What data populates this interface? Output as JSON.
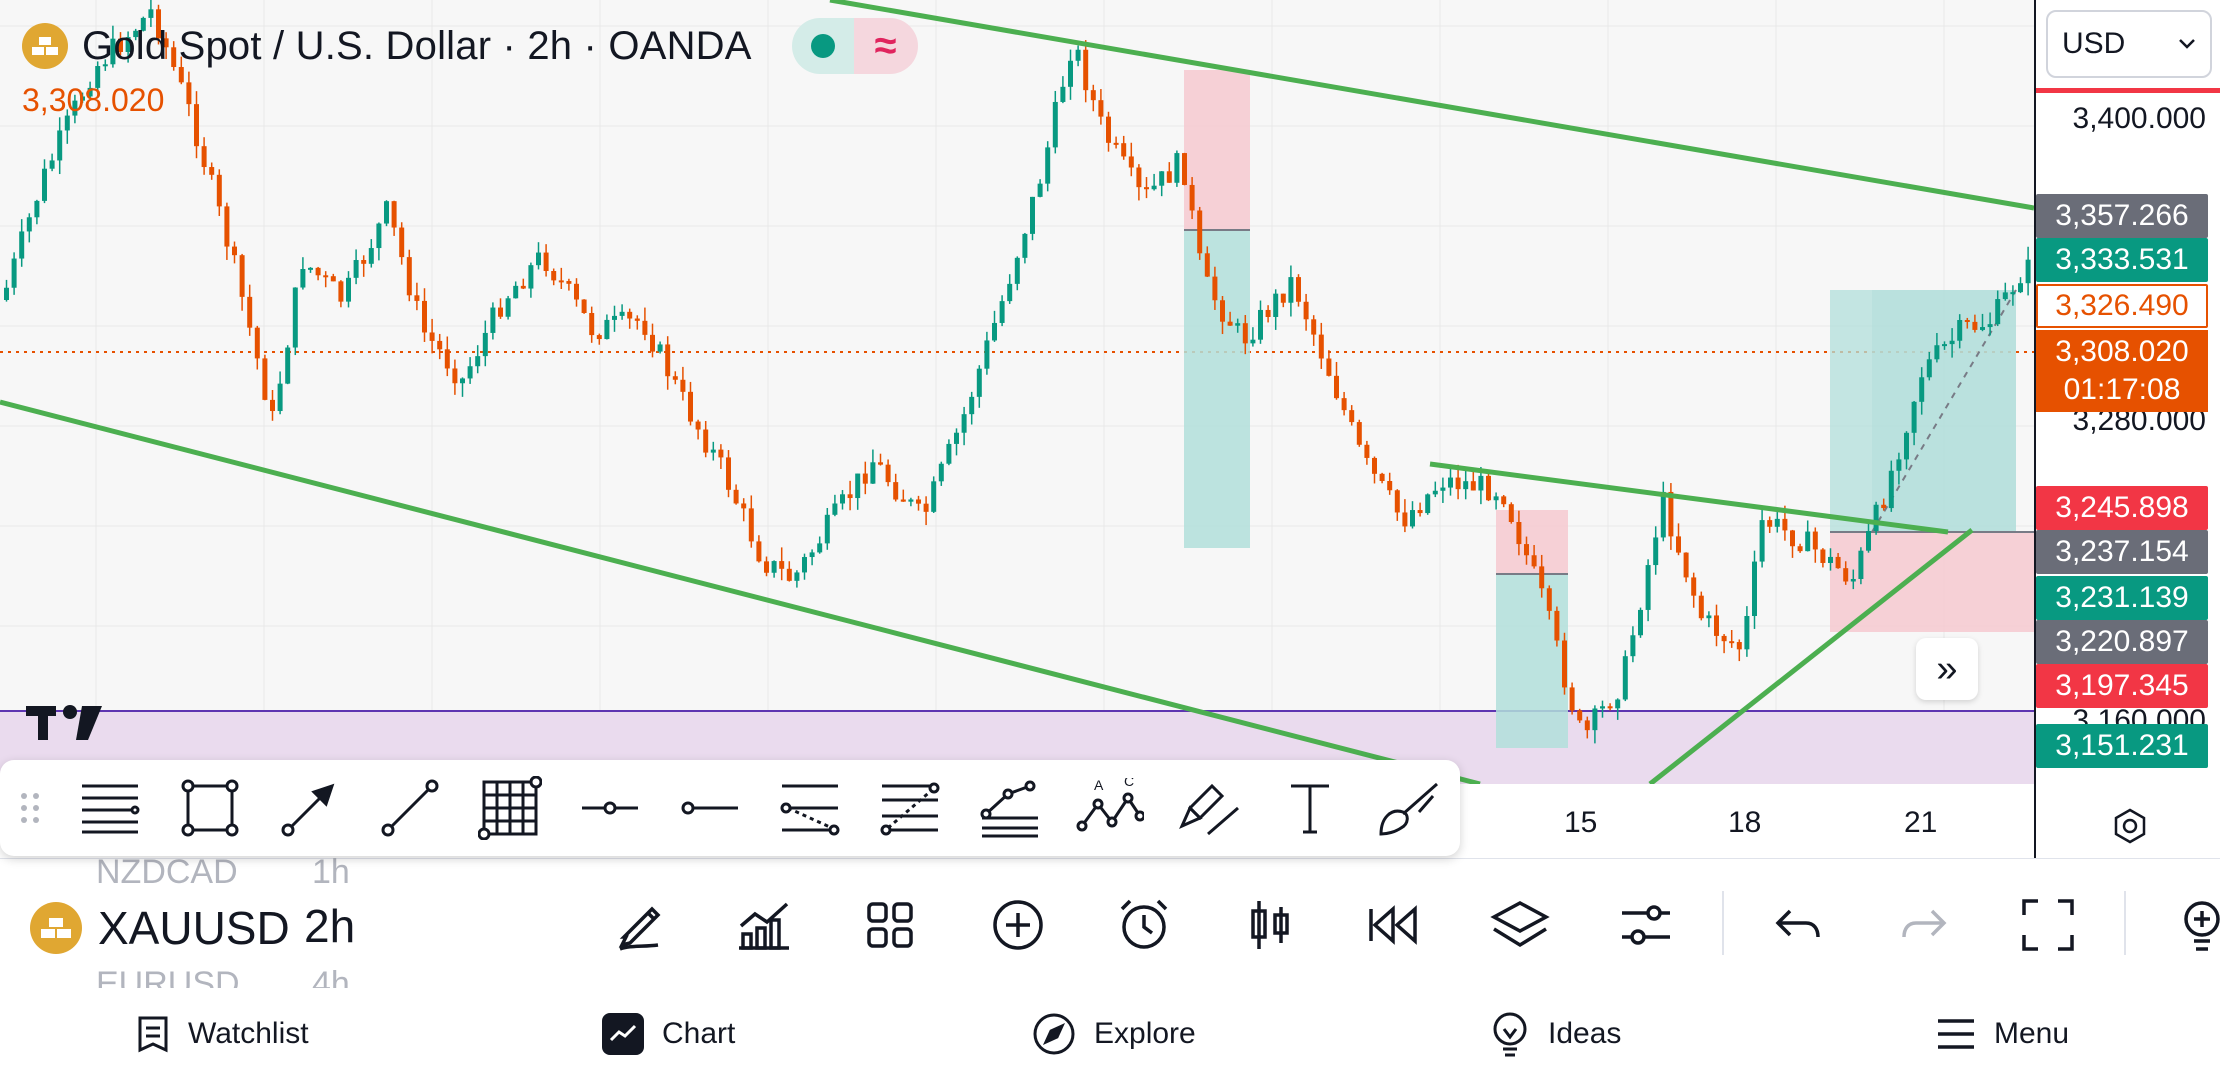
{
  "header": {
    "title": "Gold Spot / U.S. Dollar · 2h · OANDA",
    "last_price": "3,308.020",
    "indicator_icon": "≈"
  },
  "price_axis": {
    "currency": "USD",
    "ticks": [
      "3,400.000",
      "3,280.000",
      "3,160.000"
    ],
    "tags": {
      "t1": "3,357.266",
      "t2": "3,333.531",
      "t3": "3,326.490",
      "t4_price": "3,308.020",
      "t4_timer": "01:17:08",
      "t5": "3,245.898",
      "t6": "3,237.154",
      "t7": "3,231.139",
      "t8": "3,220.897",
      "t9": "3,197.345",
      "t10": "3,151.231"
    }
  },
  "date_axis": {
    "labels": [
      "15",
      "18",
      "21"
    ]
  },
  "symbol_row": {
    "symbol": "XAUUSD",
    "interval": "2h",
    "ghost_symbol_top": "NZDCAD",
    "ghost_interval_top": "1h",
    "ghost_symbol_bottom": "EURUSD",
    "ghost_interval_bottom": "4h"
  },
  "nav": {
    "watchlist": "Watchlist",
    "chart": "Chart",
    "explore": "Explore",
    "ideas": "Ideas",
    "menu": "Menu"
  },
  "colors": {
    "up": "#089981",
    "down": "#e65100",
    "trend": "#4caf50",
    "stop_zone": "#f7c7cf",
    "target_zone": "#b2dfdb",
    "support_band": "#e9d7ec",
    "grey_tag": "#6a6d78",
    "red_tag": "#f23645",
    "green_tag": "#089981"
  }
}
